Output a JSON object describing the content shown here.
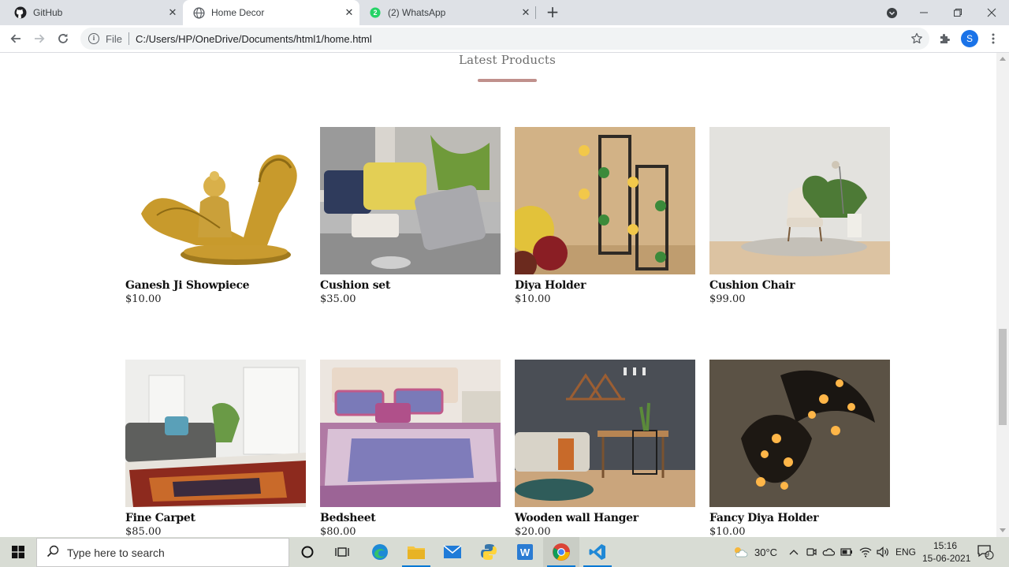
{
  "browser": {
    "tabs": [
      {
        "title": "GitHub",
        "icon": "github-icon"
      },
      {
        "title": "Home Decor",
        "icon": "globe-icon"
      },
      {
        "title": "(2) WhatsApp",
        "icon": "whatsapp-icon",
        "badge": "2"
      }
    ],
    "active_tab": 1,
    "address": {
      "scheme_label": "File",
      "url": "C:/Users/HP/OneDrive/Documents/html1/home.html"
    },
    "profile_initial": "S"
  },
  "page": {
    "section_title": "Latest Products",
    "accent_color": "#c0908c",
    "products": [
      {
        "name": "Ganesh Ji Showpiece",
        "price": "$10.00"
      },
      {
        "name": "Cushion set",
        "price": "$35.00"
      },
      {
        "name": "Diya Holder",
        "price": "$10.00"
      },
      {
        "name": "Cushion Chair",
        "price": "$99.00"
      },
      {
        "name": "Fine Carpet",
        "price": "$85.00"
      },
      {
        "name": "Bedsheet",
        "price": "$80.00"
      },
      {
        "name": "Wooden wall Hanger",
        "price": "$20.00"
      },
      {
        "name": "Fancy Diya Holder",
        "price": "$10.00"
      }
    ]
  },
  "taskbar": {
    "search_placeholder": "Type here to search",
    "weather": "30°C",
    "language": "ENG",
    "time": "15:16",
    "date": "15-06-2021",
    "notification_count": "9"
  }
}
